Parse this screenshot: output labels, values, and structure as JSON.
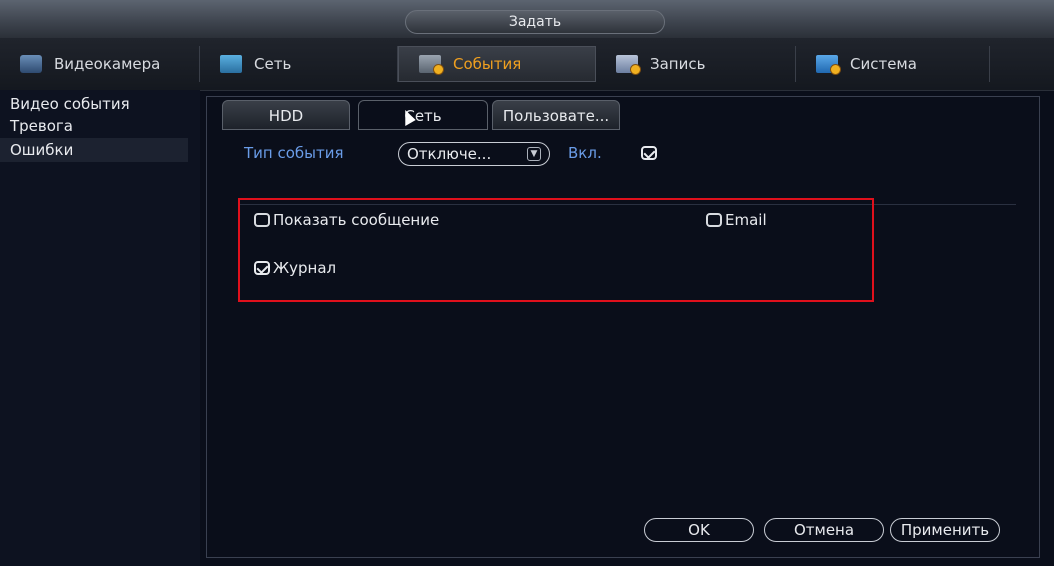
{
  "window": {
    "title": "Задать"
  },
  "main_tabs": [
    {
      "label": "Видеокамера",
      "icon": "camera-icon"
    },
    {
      "label": "Сеть",
      "icon": "network-icon"
    },
    {
      "label": "События",
      "icon": "events-icon",
      "active": true
    },
    {
      "label": "Запись",
      "icon": "record-icon"
    },
    {
      "label": "Система",
      "icon": "system-icon"
    }
  ],
  "sidebar": {
    "items": [
      {
        "label": "Видео события"
      },
      {
        "label": "Тревога"
      },
      {
        "label": "Ошибки",
        "active": true
      }
    ]
  },
  "sub_tabs": [
    {
      "label": "HDD"
    },
    {
      "label": "Сеть",
      "active": true
    },
    {
      "label": "Пользовате..."
    }
  ],
  "event_type": {
    "label": "Тип события",
    "value": "Отключе...",
    "enable_label": "Вкл.",
    "enabled": true
  },
  "options": {
    "show_message": {
      "label": "Показать сообщение",
      "checked": false
    },
    "email": {
      "label": "Email",
      "checked": false
    },
    "log": {
      "label": "Журнал",
      "checked": true
    }
  },
  "buttons": {
    "ok": "OK",
    "cancel": "Отмена",
    "apply": "Применить"
  },
  "colors": {
    "active_tab": "#f0a020",
    "highlight_box": "#e0101c",
    "label_blue": "#6a9ce8"
  }
}
